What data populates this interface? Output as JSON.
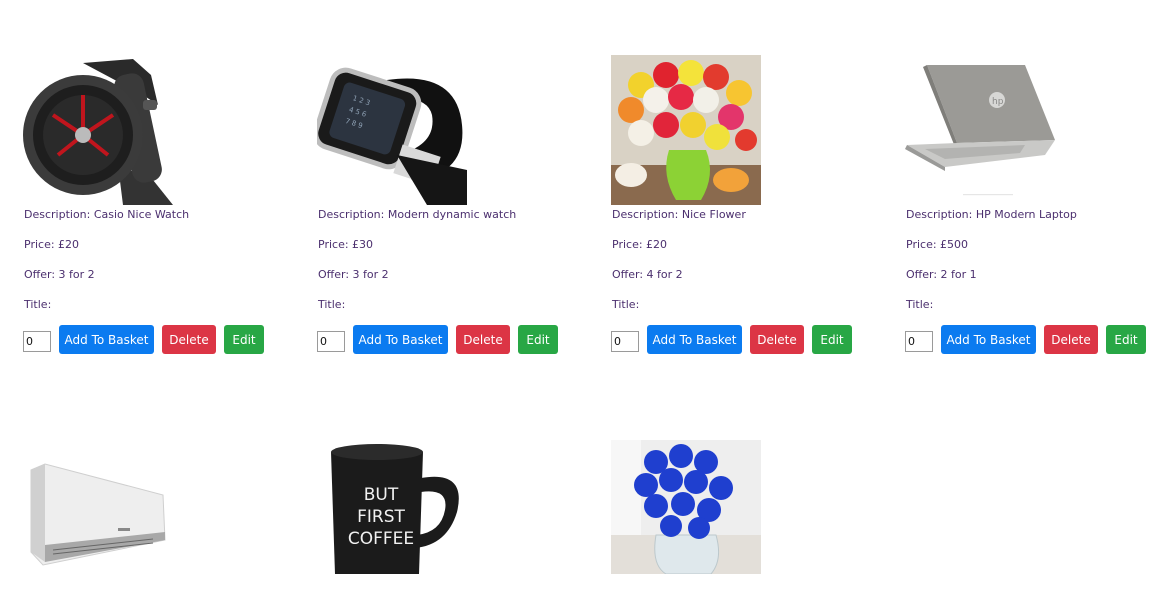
{
  "labels": {
    "description_prefix": "Description: ",
    "price_prefix": "Price: ",
    "offer_prefix": "Offer: ",
    "title_prefix": "Title:",
    "add_to_basket": "Add To Basket",
    "delete": "Delete",
    "edit": "Edit"
  },
  "products": [
    {
      "description": "Description: Casio Nice Watch",
      "price": "Price: £20",
      "offer": "Offer: 3 for 2",
      "title": "Title:",
      "quantity": "0",
      "image": "watch-image"
    },
    {
      "description": "Description: Modern dynamic watch",
      "price": "Price: £30",
      "offer": "Offer: 3 for 2",
      "title": "Title:",
      "quantity": "0",
      "image": "smartwatch-image"
    },
    {
      "description": "Description: Nice Flower",
      "price": "Price: £20",
      "offer": "Offer: 4 for 2",
      "title": "Title:",
      "quantity": "0",
      "image": "roses-image"
    },
    {
      "description": "Description: HP Modern Laptop",
      "price": "Price: £500",
      "offer": "Offer: 2 for 1",
      "title": "Title:",
      "quantity": "0",
      "image": "laptop-image"
    }
  ],
  "products_row2": [
    {
      "image": "air-conditioner-image"
    },
    {
      "image": "mug-image",
      "mug_text": [
        "BUT",
        "FIRST",
        "COFFEE"
      ]
    },
    {
      "image": "blue-roses-image"
    }
  ],
  "colors": {
    "basket_button": "#0b7bf0",
    "delete_button": "#dc3545",
    "edit_button": "#28a745",
    "text": "#4b2f6e"
  }
}
